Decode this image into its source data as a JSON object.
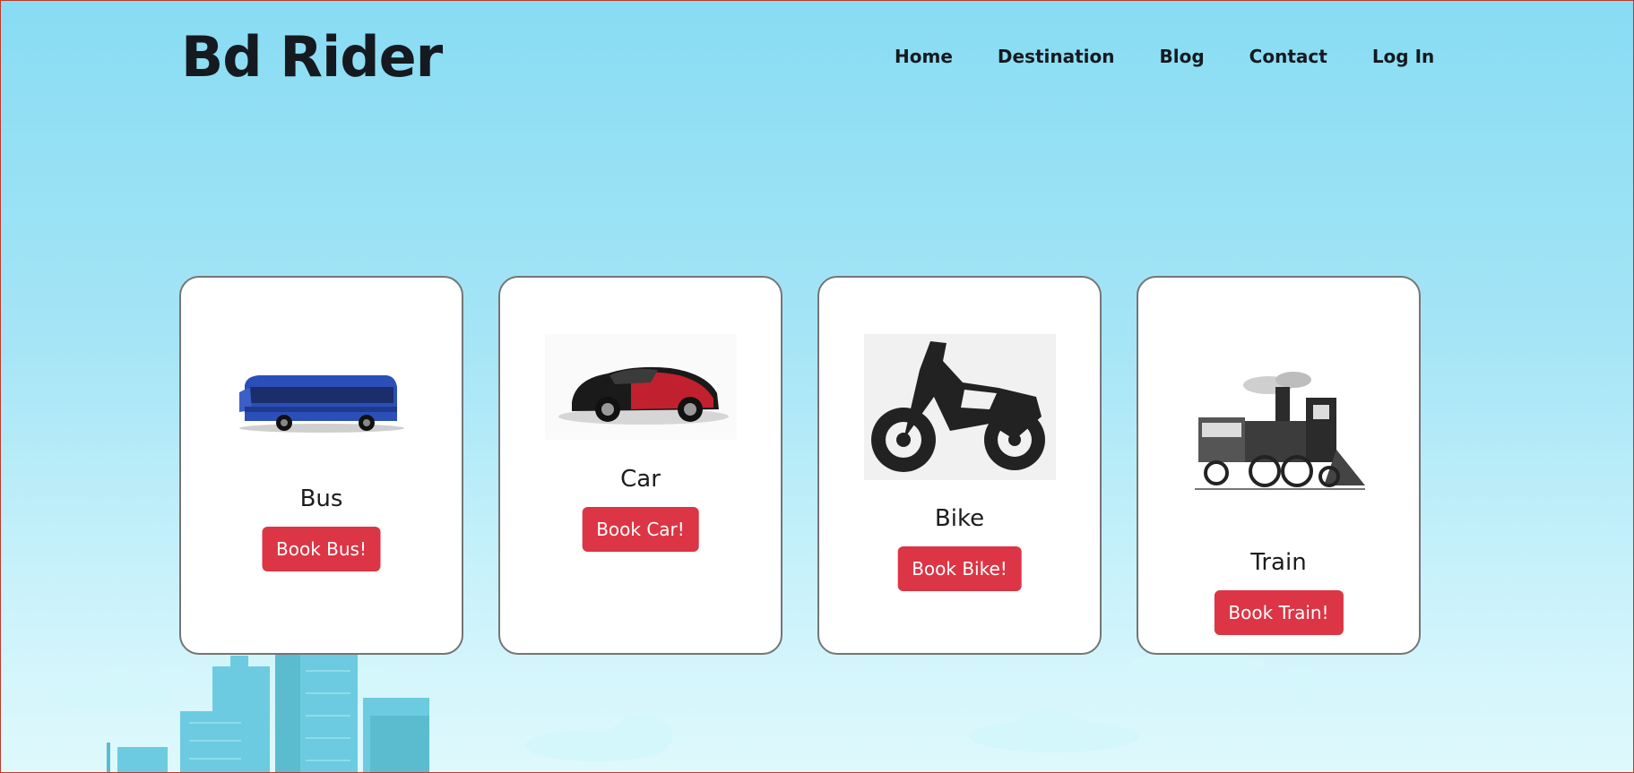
{
  "header": {
    "brand": "Bd Rider",
    "nav": [
      "Home",
      "Destination",
      "Blog",
      "Contact",
      "Log In"
    ]
  },
  "cards": [
    {
      "title": "Bus",
      "button": "Book Bus!",
      "image": "bus-image"
    },
    {
      "title": "Car",
      "button": "Book Car!",
      "image": "car-image"
    },
    {
      "title": "Bike",
      "button": "Book Bike!",
      "image": "bike-image"
    },
    {
      "title": "Train",
      "button": "Book Train!",
      "image": "train-image"
    }
  ],
  "colors": {
    "accent": "#dc3545",
    "sky_top": "#88dcf3",
    "sky_bottom": "#dff9fc",
    "text": "#141a1f"
  }
}
